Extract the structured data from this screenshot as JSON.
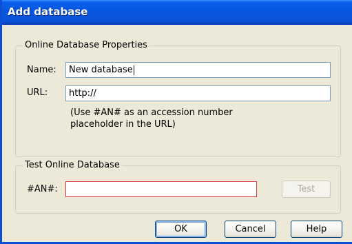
{
  "window": {
    "title": "Add database"
  },
  "properties_group": {
    "legend": "Online Database Properties",
    "name_label": "Name:",
    "name_value": "New database",
    "url_label": "URL:",
    "url_value": "http://",
    "hint_line1": "(Use #AN# as an accession number",
    "hint_line2": "placeholder in the URL)"
  },
  "test_group": {
    "legend": "Test Online Database",
    "an_label": "#AN#:",
    "an_value": "",
    "test_label": "Test"
  },
  "buttons": {
    "ok_label": "OK",
    "cancel_label": "Cancel",
    "help_label": "Help"
  }
}
